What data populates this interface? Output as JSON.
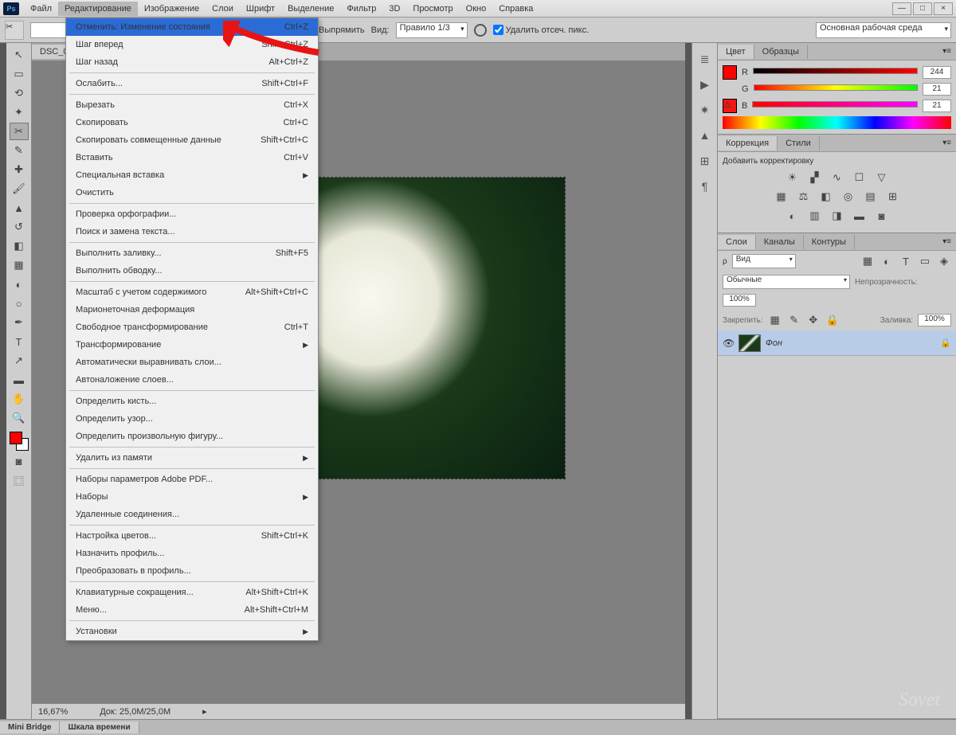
{
  "app": {
    "logo": "Ps"
  },
  "menubar": [
    "Файл",
    "Редактирование",
    "Изображение",
    "Слои",
    "Шрифт",
    "Выделение",
    "Фильтр",
    "3D",
    "Просмотр",
    "Окно",
    "Справка"
  ],
  "win": {
    "min": "—",
    "max": "□",
    "close": "×"
  },
  "options": {
    "straighten": "Выпрямить",
    "view_lbl": "Вид:",
    "view_val": "Правило 1/3",
    "del_pixels": "Удалить отсеч. пикс.",
    "workspace": "Основная рабочая среда"
  },
  "doc": {
    "tab": "DSC_0...",
    "zoom": "16,67%",
    "info": "Док: 25,0М/25,0М"
  },
  "edit_menu": [
    {
      "t": "Отменить: Изменение состояния",
      "s": "Ctrl+Z",
      "hl": true
    },
    {
      "t": "Шаг вперед",
      "s": "Shift+Ctrl+Z"
    },
    {
      "t": "Шаг назад",
      "s": "Alt+Ctrl+Z"
    },
    {
      "sep": true
    },
    {
      "t": "Ослабить...",
      "s": "Shift+Ctrl+F",
      "dis": true
    },
    {
      "sep": true
    },
    {
      "t": "Вырезать",
      "s": "Ctrl+X"
    },
    {
      "t": "Скопировать",
      "s": "Ctrl+C"
    },
    {
      "t": "Скопировать совмещенные данные",
      "s": "Shift+Ctrl+C"
    },
    {
      "t": "Вставить",
      "s": "Ctrl+V"
    },
    {
      "t": "Специальная вставка",
      "sub": true
    },
    {
      "t": "Очистить"
    },
    {
      "sep": true
    },
    {
      "t": "Проверка орфографии...",
      "dis": true
    },
    {
      "t": "Поиск и замена текста...",
      "dis": true
    },
    {
      "sep": true
    },
    {
      "t": "Выполнить заливку...",
      "s": "Shift+F5"
    },
    {
      "t": "Выполнить обводку...",
      "dis": true
    },
    {
      "sep": true
    },
    {
      "t": "Масштаб с учетом содержимого",
      "s": "Alt+Shift+Ctrl+C",
      "dis": true
    },
    {
      "t": "Марионеточная деформация",
      "dis": true
    },
    {
      "t": "Свободное трансформирование",
      "s": "Ctrl+T",
      "dis": true
    },
    {
      "t": "Трансформирование",
      "sub": true,
      "dis": true
    },
    {
      "t": "Автоматически выравнивать слои...",
      "dis": true
    },
    {
      "t": "Автоналожение слоев...",
      "dis": true
    },
    {
      "sep": true
    },
    {
      "t": "Определить кисть..."
    },
    {
      "t": "Определить узор..."
    },
    {
      "t": "Определить произвольную фигуру...",
      "dis": true
    },
    {
      "sep": true
    },
    {
      "t": "Удалить из памяти",
      "sub": true
    },
    {
      "sep": true
    },
    {
      "t": "Наборы параметров Adobe PDF..."
    },
    {
      "t": "Наборы",
      "sub": true
    },
    {
      "t": "Удаленные соединения..."
    },
    {
      "sep": true
    },
    {
      "t": "Настройка цветов...",
      "s": "Shift+Ctrl+K"
    },
    {
      "t": "Назначить профиль..."
    },
    {
      "t": "Преобразовать в профиль..."
    },
    {
      "sep": true
    },
    {
      "t": "Клавиатурные сокращения...",
      "s": "Alt+Shift+Ctrl+K"
    },
    {
      "t": "Меню...",
      "s": "Alt+Shift+Ctrl+M"
    },
    {
      "sep": true
    },
    {
      "t": "Установки",
      "sub": true
    }
  ],
  "panels": {
    "color": {
      "tabs": [
        "Цвет",
        "Образцы"
      ],
      "r": "244",
      "g": "21",
      "b": "21",
      "rl": "R",
      "gl": "G",
      "bl": "B"
    },
    "correction": {
      "tabs": [
        "Коррекция",
        "Стили"
      ],
      "add": "Добавить корректировку"
    },
    "layers": {
      "tabs": [
        "Слои",
        "Каналы",
        "Контуры"
      ],
      "kind": "Вид",
      "blend": "Обычные",
      "opacity_lbl": "Непрозрачность:",
      "opacity": "100%",
      "lock_lbl": "Закрепить:",
      "fill_lbl": "Заливка:",
      "fill": "100%",
      "layer_name": "Фон"
    }
  },
  "bottom_tabs": [
    "Mini Bridge",
    "Шкала времени"
  ],
  "watermark": "Sovet"
}
